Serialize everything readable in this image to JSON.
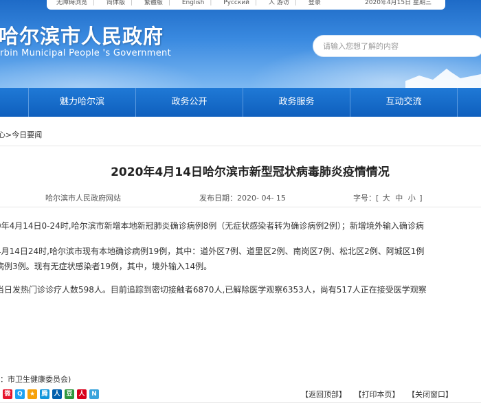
{
  "topbar": {
    "links": [
      "无障碍浏览",
      "简体版",
      "繁體版",
      "English",
      "Русский",
      "人 游访",
      "登录"
    ],
    "date": "2020年4月15日 星期三"
  },
  "header": {
    "title": "哈尔滨市人民政府",
    "subtitle": "rbin Municipal People 's Government",
    "search_placeholder": "请输入您想了解的内容"
  },
  "nav": {
    "items": [
      "",
      "魅力哈尔滨",
      "政务公开",
      "政务服务",
      "互动交流",
      ""
    ]
  },
  "breadcrumb": {
    "parent": "心",
    "separator": ">",
    "current": "今日要闻"
  },
  "article": {
    "title": "2020年4月14日哈尔滨市新型冠状病毒肺炎疫情情况",
    "source": "哈尔滨市人民政府网站",
    "date_label": "发布日期：",
    "date": "2020- 04- 15",
    "size_label": "字号：[",
    "size_large": "大",
    "size_medium": "中",
    "size_small": "小",
    "size_end": "]",
    "paragraphs": [
      "0年4月14日0-24时,哈尔滨市新增本地新冠肺炎确诊病例8例（无症状感染者转为确诊病例2例）；新增境外输入确诊病",
      "4月14日24时,哈尔滨市现有本地确诊病例19例，其中：道外区7例、道里区2例、南岗区7例、松北区2例、阿城区1例",
      "病例3例。现有无症状感染者19例，其中，境外输入14例。",
      "当日发热门诊诊疗人数598人。目前追踪到密切接触者6870人,已解除医学观察6353人，尚有517人正在接受医学观察"
    ],
    "editor": "：市卫生健康委员会)"
  },
  "share": {
    "icons": [
      {
        "name": "weibo-icon",
        "glyph": "微",
        "color": "#e6162d"
      },
      {
        "name": "qzone-icon",
        "glyph": "Q",
        "color": "#1da1f2"
      },
      {
        "name": "star-icon",
        "glyph": "★",
        "color": "#f7a10a"
      },
      {
        "name": "tencent-icon",
        "glyph": "腾",
        "color": "#1296db"
      },
      {
        "name": "renren-icon",
        "glyph": "人",
        "color": "#005eac"
      },
      {
        "name": "douban-icon",
        "glyph": "豆",
        "color": "#2e963d"
      },
      {
        "name": "people-icon",
        "glyph": "人",
        "color": "#d9001b"
      },
      {
        "name": "more-icon",
        "glyph": "N",
        "color": "#39a4dc"
      }
    ]
  },
  "actions": {
    "back_top": "【返回顶部】",
    "print": "【打印本页】",
    "close": "【关闭窗口】"
  }
}
